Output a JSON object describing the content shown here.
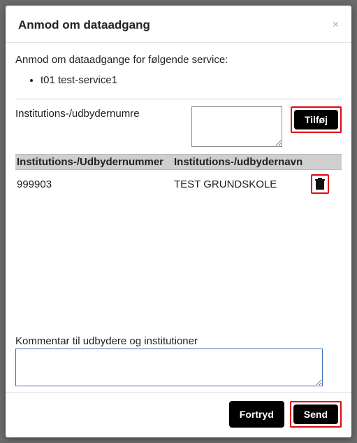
{
  "modal": {
    "title": "Anmod om dataadgang",
    "close_symbol": "×"
  },
  "intro": "Anmod om dataadgange for følgende service:",
  "services": [
    "t01 test-service1"
  ],
  "input_section": {
    "label": "Institutions-/udbydernumre",
    "value": "",
    "add_button": "Tilføj"
  },
  "table": {
    "header": {
      "col1": "Institutions-/Udbydernummer",
      "col2": "Institutions-/udbydernavn"
    },
    "rows": [
      {
        "number": "999903",
        "name": "TEST GRUNDSKOLE"
      }
    ]
  },
  "comment": {
    "label": "Kommentar til udbydere og institutioner",
    "value": ""
  },
  "footer": {
    "cancel": "Fortryd",
    "send": "Send"
  }
}
